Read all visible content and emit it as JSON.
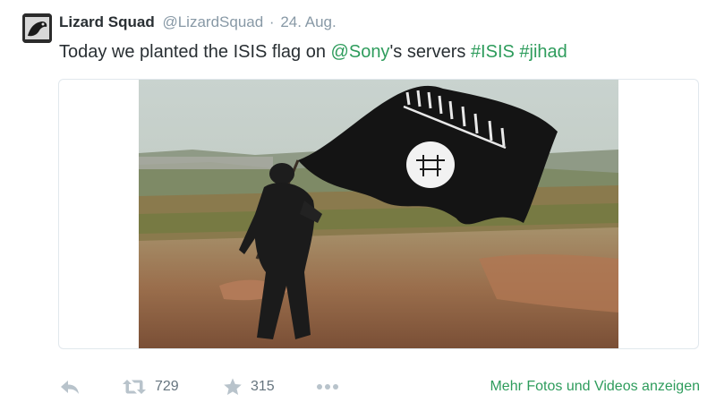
{
  "tweet": {
    "display_name": "Lizard Squad",
    "handle": "@LizardSquad",
    "separator": "·",
    "date": "24. Aug.",
    "text_prefix": "Today we planted the ISIS flag on ",
    "mention": "@Sony",
    "text_middle": "'s servers ",
    "hashtag1": "#ISIS",
    "hashtag2": "#jihad",
    "photo_description_icon": "photo-image"
  },
  "actions": {
    "reply_icon": "reply-icon",
    "retweet_icon": "retweet-icon",
    "retweet_count": "729",
    "favorite_icon": "star-icon",
    "favorite_count": "315",
    "more_icon": "more-dots-icon",
    "more_link": "Mehr Fotos und Videos anzeigen"
  },
  "colors": {
    "link": "#2e9c5c",
    "meta": "#8899a6",
    "text": "#292f33"
  }
}
